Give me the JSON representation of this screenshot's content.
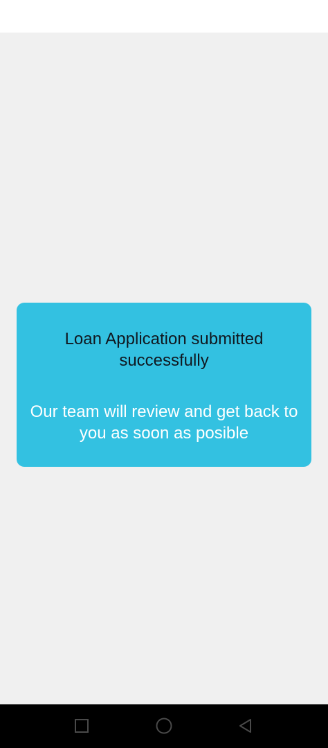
{
  "dialog": {
    "title": "Loan Application submitted successfully",
    "message": "Our team will review and get back to you as soon as posible"
  },
  "colors": {
    "dialog_background": "#33c1e1",
    "page_background": "#f0f0f0",
    "nav_bar": "#000000"
  },
  "nav_bar": {
    "recents_icon": "square-icon",
    "home_icon": "circle-icon",
    "back_icon": "triangle-back-icon"
  }
}
